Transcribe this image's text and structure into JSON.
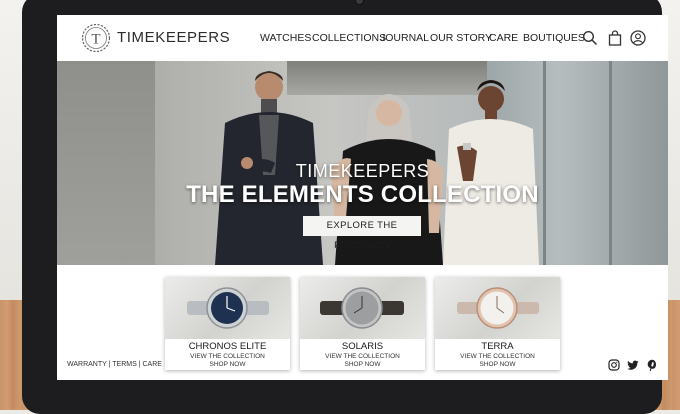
{
  "brand": {
    "name": "TIMEKEEPERS",
    "logo_letter": "T"
  },
  "nav": {
    "items": [
      "WATCHES",
      "COLLECTIONS",
      "JOURNAL",
      "OUR STORY",
      "CARE",
      "BOUTIQUES"
    ]
  },
  "header_icons": [
    "search-icon",
    "bag-icon",
    "account-icon"
  ],
  "hero": {
    "brand": "TIMEKEEPERS",
    "title": "THE ELEMENTS COLLECTION",
    "cta_label": "EXPLORE THE PRECISION"
  },
  "products": [
    {
      "name": "CHRONOS ELITE",
      "link": "VIEW THE COLLECTION",
      "shop": "SHOP NOW",
      "dial_color": "#1f3150",
      "strap_color": "#b9bcc0"
    },
    {
      "name": "SOLARIS",
      "link": "VIEW THE COLLECTION",
      "shop": "SHOP NOW",
      "dial_color": "#9d9ea0",
      "strap_color": "#3b3833"
    },
    {
      "name": "TERRA",
      "link": "VIEW THE COLLECTION",
      "shop": "SHOP NOW",
      "dial_color": "#f3f1ee",
      "strap_color": "#cbb9ad"
    }
  ],
  "footer": {
    "links": [
      "WARRANTY",
      "TERMS",
      "CARE"
    ],
    "separator": " | "
  },
  "social": [
    "instagram-icon",
    "twitter-icon",
    "pinterest-icon"
  ],
  "colors": {
    "text": "#222222",
    "laptop_bezel": "#1d1c1f",
    "cta_bg": "#f4f4f2"
  }
}
